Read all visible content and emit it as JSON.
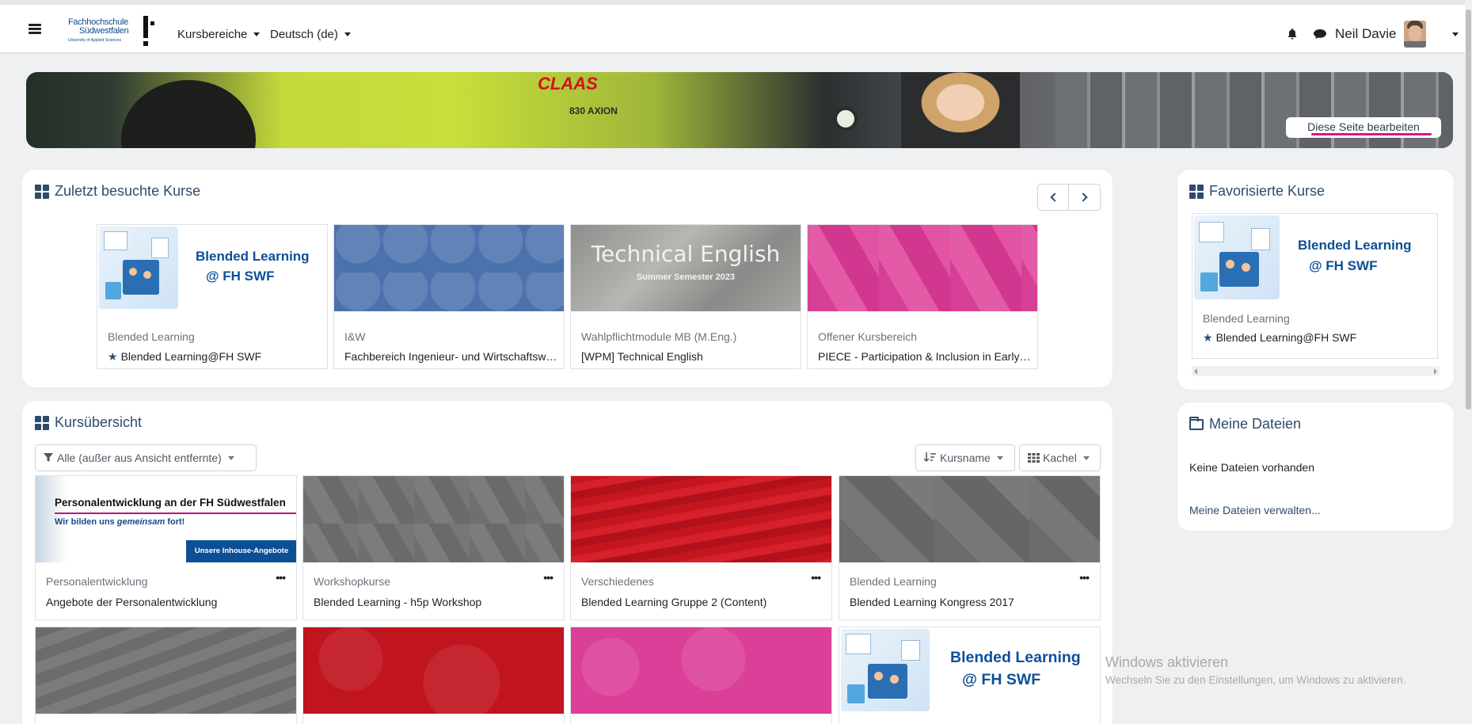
{
  "navbar": {
    "logo": {
      "line1": "Fachhochschule",
      "line2": "Südwestfalen",
      "line3": "University of Applied Sciences"
    },
    "menu": [
      {
        "label": "Kursbereiche"
      },
      {
        "label": "Deutsch (de)"
      }
    ],
    "user_name": "Neil Davie",
    "icons": [
      "hamburger-icon",
      "bell-icon",
      "chat-icon",
      "chevron-down-icon"
    ]
  },
  "banner": {
    "edit_button": "Diese Seite bearbeiten",
    "artwork": {
      "brand": "CLAAS",
      "model": "830 AXION"
    }
  },
  "recent": {
    "title": "Zuletzt besuchte Kurse",
    "items": [
      {
        "category": "Blended Learning",
        "name": "Blended Learning@FH SWF",
        "starred": true,
        "image_text": "Blended Learning",
        "image_text2": "@ FH SWF"
      },
      {
        "category": "I&W",
        "name": "Fachbereich Ingenieur- und Wirtschaftswissenschaften",
        "starred": false
      },
      {
        "category": "Wahlpflichtmodule MB (M.Eng.)",
        "name": "[WPM] Technical English",
        "starred": false,
        "image_text": "Technical English",
        "image_subtext": "Summer Semester 2023"
      },
      {
        "category": "Offener Kursbereich",
        "name": "PIECE - Participation & Inclusion in Early Childhood Education",
        "starred": false
      }
    ]
  },
  "favorites": {
    "title": "Favorisierte Kurse",
    "item": {
      "category": "Blended Learning",
      "name": "Blended Learning@FH SWF",
      "image_text": "Blended Learning",
      "image_text2": "@ FH SWF"
    }
  },
  "files": {
    "title": "Meine Dateien",
    "empty_text": "Keine Dateien vorhanden",
    "manage_link": "Meine Dateien verwalten..."
  },
  "overview": {
    "title": "Kursübersicht",
    "filter_label": "Alle (außer aus Ansicht entfernte)",
    "sort_label": "Kursname",
    "view_label": "Kachel",
    "courses": [
      {
        "category": "Personalentwicklung",
        "name": "Angebote der Personalentwicklung",
        "image": {
          "heading": "Personalentwicklung an der FH Südwestfalen",
          "sub_prefix": "Wir bilden uns",
          "sub_emph": "gemeinsam",
          "sub_suffix": "fort!",
          "button": "Unsere Inhouse-Angebote"
        }
      },
      {
        "category": "Workshopkurse",
        "name": "Blended Learning - h5p Workshop"
      },
      {
        "category": "Verschiedenes",
        "name": "Blended Learning Gruppe 2 (Content)"
      },
      {
        "category": "Blended Learning",
        "name": "Blended Learning Kongress 2017"
      }
    ],
    "row2_image_text": {
      "line1": "Blended Learning",
      "line2": "@ FH SWF"
    },
    "more_label": "•••"
  },
  "watermark": {
    "line1": "Windows aktivieren",
    "line2": "Wechseln Sie zu den Einstellungen, um Windows zu aktivieren."
  },
  "colors": {
    "accent": "#2f4b6c",
    "brand_blue": "#0d4f97",
    "edit_underline": "#e0158a"
  }
}
